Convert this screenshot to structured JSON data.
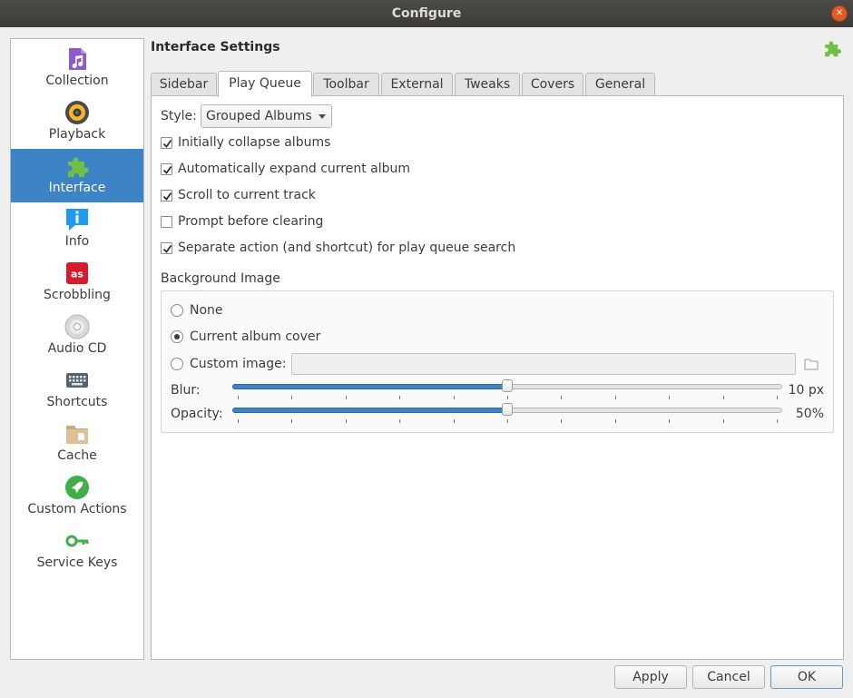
{
  "window": {
    "title": "Configure"
  },
  "sidebar": {
    "items": [
      {
        "label": "Collection",
        "icon": "music-file-icon"
      },
      {
        "label": "Playback",
        "icon": "speaker-icon"
      },
      {
        "label": "Interface",
        "icon": "puzzle-icon",
        "active": true
      },
      {
        "label": "Info",
        "icon": "info-icon"
      },
      {
        "label": "Scrobbling",
        "icon": "lastfm-icon"
      },
      {
        "label": "Audio CD",
        "icon": "cd-icon"
      },
      {
        "label": "Shortcuts",
        "icon": "keyboard-icon"
      },
      {
        "label": "Cache",
        "icon": "folder-icon"
      },
      {
        "label": "Custom Actions",
        "icon": "rocket-icon"
      },
      {
        "label": "Service Keys",
        "icon": "key-icon"
      }
    ]
  },
  "panel": {
    "title": "Interface Settings"
  },
  "tabs": [
    "Sidebar",
    "Play Queue",
    "Toolbar",
    "External",
    "Tweaks",
    "Covers",
    "General"
  ],
  "active_tab": "Play Queue",
  "play_queue": {
    "style_label": "Style:",
    "style_value": "Grouped Albums",
    "checkboxes": [
      {
        "label": "Initially collapse albums",
        "checked": true
      },
      {
        "label": "Automatically expand current album",
        "checked": true
      },
      {
        "label": "Scroll to current track",
        "checked": true
      },
      {
        "label": "Prompt before clearing",
        "checked": false
      },
      {
        "label": "Separate action (and shortcut) for play queue search",
        "checked": true
      }
    ],
    "background": {
      "title": "Background Image",
      "options": [
        {
          "label": "None",
          "selected": false
        },
        {
          "label": "Current album cover",
          "selected": true
        },
        {
          "label": "Custom image:",
          "selected": false
        }
      ],
      "custom_image_value": "",
      "blur": {
        "label": "Blur:",
        "value_text": "10 px",
        "fraction": 0.5
      },
      "opacity": {
        "label": "Opacity:",
        "value_text": "50%",
        "fraction": 0.5
      }
    }
  },
  "buttons": {
    "apply": "Apply",
    "cancel": "Cancel",
    "ok": "OK"
  },
  "colors": {
    "accent": "#3c84c6",
    "puzzle_green": "#6fc144"
  }
}
